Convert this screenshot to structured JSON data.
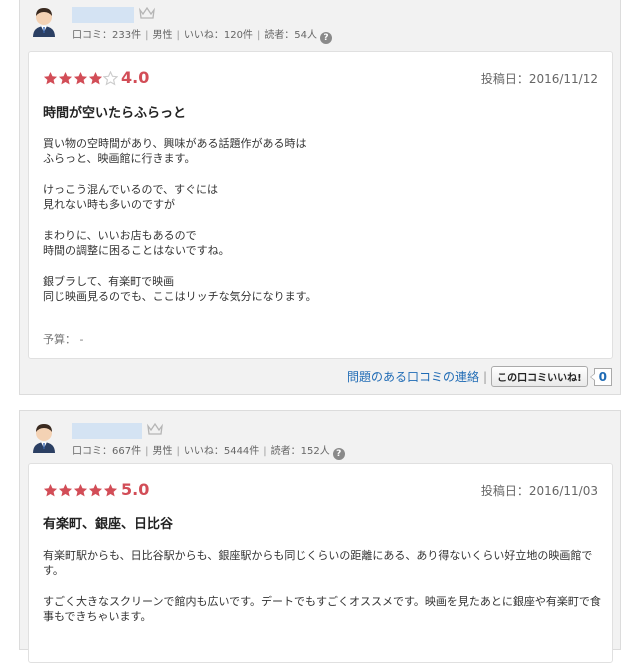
{
  "colors": {
    "star_filled": "#d24d57",
    "star_empty": "#cccccc",
    "score": "#d24d57",
    "link": "#1f6bb5"
  },
  "reviews": [
    {
      "reviewer": {
        "stats_reviews": "口コミ：233件",
        "stats_gender": "男性",
        "stats_likes": "いいね：120件",
        "stats_readers": "読者：54人",
        "help_icon": "?"
      },
      "rating": 4.0,
      "rating_label": "4.0",
      "post_date": "投稿日：2016/11/12",
      "title": "時間が空いたらふらっと",
      "paragraphs": [
        "買い物の空時間があり、興味がある話題作がある時は\nふらっと、映画館に行きます。",
        "けっこう混んでいるので、すぐには\n見れない時も多いのですが",
        "まわりに、いいお店もあるので\n時間の調整に困ることはないですね。",
        "銀ブラして、有楽町で映画\n同じ映画見るのでも、ここはリッチな気分になります。"
      ],
      "budget": "予算：  -",
      "report_link": "問題のある口コミの連絡",
      "like_button": "この口コミいいね!",
      "like_count": "0"
    },
    {
      "reviewer": {
        "stats_reviews": "口コミ：667件",
        "stats_gender": "男性",
        "stats_likes": "いいね：5444件",
        "stats_readers": "読者：152人",
        "help_icon": "?"
      },
      "rating": 5.0,
      "rating_label": "5.0",
      "post_date": "投稿日：2016/11/03",
      "title": "有楽町、銀座、日比谷",
      "paragraphs": [
        "有楽町駅からも、日比谷駅からも、銀座駅からも同じくらいの距離にある、あり得ないくらい好立地の映画館です。",
        "すごく大きなスクリーンで館内も広いです。デートでもすごくオススメです。映画を見たあとに銀座や有楽町で食事もできちゃいます。"
      ]
    }
  ]
}
